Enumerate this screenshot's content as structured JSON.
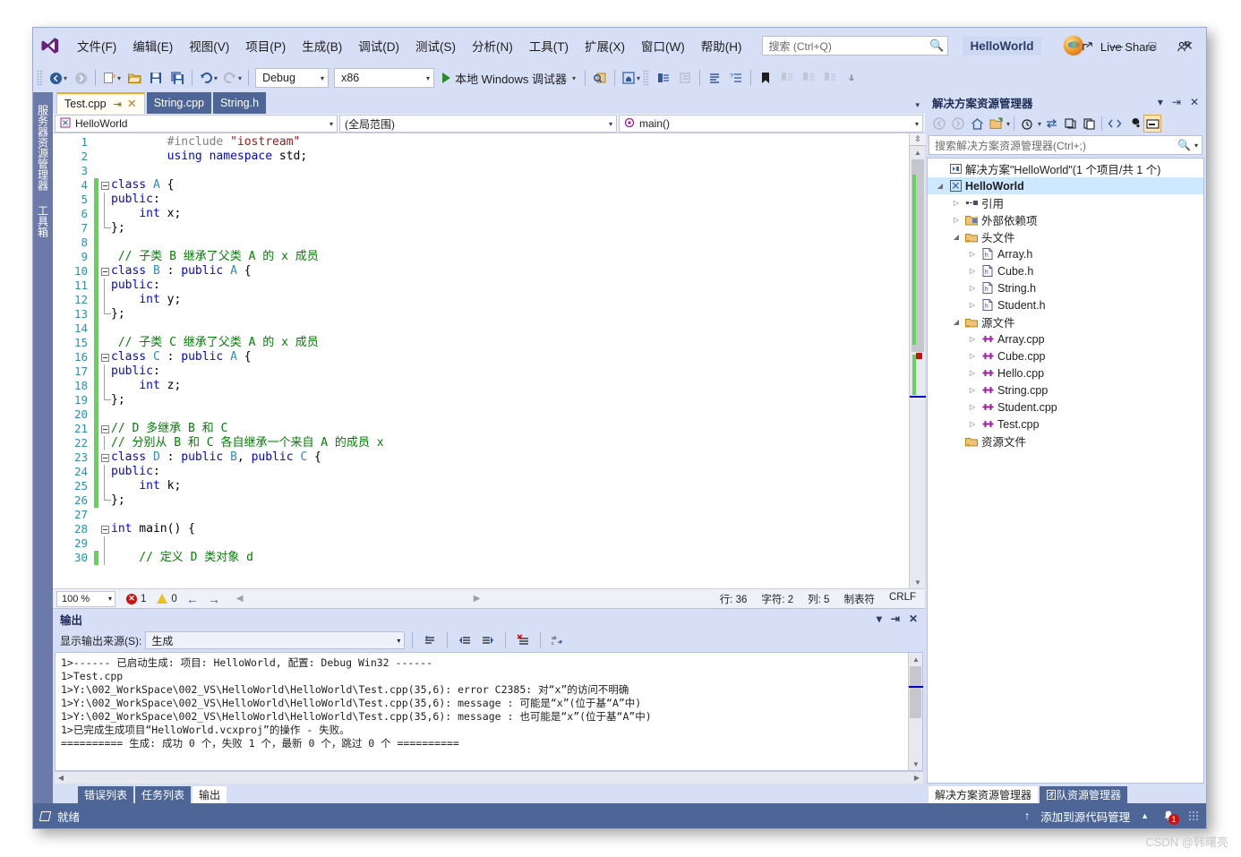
{
  "window": {
    "title": "HelloWorld",
    "minimize": "—",
    "maximize": "□",
    "close": "✕"
  },
  "menu": {
    "items": [
      {
        "label": "文件(F)"
      },
      {
        "label": "编辑(E)"
      },
      {
        "label": "视图(V)"
      },
      {
        "label": "项目(P)"
      },
      {
        "label": "生成(B)"
      },
      {
        "label": "调试(D)"
      },
      {
        "label": "测试(S)"
      },
      {
        "label": "分析(N)"
      },
      {
        "label": "工具(T)"
      },
      {
        "label": "扩展(X)"
      },
      {
        "label": "窗口(W)"
      },
      {
        "label": "帮助(H)"
      }
    ],
    "search_placeholder": "搜索 (Ctrl+Q)"
  },
  "toolbar": {
    "config_value": "Debug",
    "platform_value": "x86",
    "run_label": "本地 Windows 调试器",
    "live_share_label": "Live Share"
  },
  "left_strip": {
    "tabs": [
      "服务器资源管理器",
      "工具箱"
    ]
  },
  "editor": {
    "tabs": [
      {
        "label": "Test.cpp",
        "active": true,
        "pin": "⇥",
        "close": "✕"
      },
      {
        "label": "String.cpp",
        "active": false
      },
      {
        "label": "String.h",
        "active": false
      }
    ],
    "nav": {
      "project": "HelloWorld",
      "scope": "(全局范围)",
      "member": "main()"
    },
    "lines": [
      {
        "n": 1,
        "change": false,
        "fold": "",
        "segs": [
          {
            "t": "        ",
            "c": "pl"
          },
          {
            "t": "#include ",
            "c": "pp"
          },
          {
            "t": "\"iostream\"",
            "c": "str"
          }
        ]
      },
      {
        "n": 2,
        "change": false,
        "fold": "",
        "segs": [
          {
            "t": "        ",
            "c": "pl"
          },
          {
            "t": "using",
            "c": "kw"
          },
          {
            "t": " ",
            "c": "pl"
          },
          {
            "t": "namespace",
            "c": "kw"
          },
          {
            "t": " std;",
            "c": "pl"
          }
        ]
      },
      {
        "n": 3,
        "change": false,
        "fold": "",
        "segs": []
      },
      {
        "n": 4,
        "change": true,
        "fold": "minus",
        "segs": [
          {
            "t": "class",
            "c": "kw"
          },
          {
            "t": " ",
            "c": "pl"
          },
          {
            "t": "A",
            "c": "ty"
          },
          {
            "t": " {",
            "c": "pl"
          }
        ]
      },
      {
        "n": 5,
        "change": true,
        "fold": "bar",
        "segs": [
          {
            "t": "public",
            "c": "kw"
          },
          {
            "t": ":",
            "c": "pl"
          }
        ]
      },
      {
        "n": 6,
        "change": true,
        "fold": "bar",
        "segs": [
          {
            "t": "    ",
            "c": "pl"
          },
          {
            "t": "int",
            "c": "kw"
          },
          {
            "t": " x;",
            "c": "pl"
          }
        ]
      },
      {
        "n": 7,
        "change": true,
        "fold": "end",
        "segs": [
          {
            "t": "};",
            "c": "pl"
          }
        ]
      },
      {
        "n": 8,
        "change": true,
        "fold": "",
        "segs": []
      },
      {
        "n": 9,
        "change": true,
        "fold": "",
        "segs": [
          {
            "t": " // 子类 B 继承了父类 A 的 x 成员",
            "c": "cmt"
          }
        ]
      },
      {
        "n": 10,
        "change": true,
        "fold": "minus",
        "segs": [
          {
            "t": "class",
            "c": "kw"
          },
          {
            "t": " ",
            "c": "pl"
          },
          {
            "t": "B",
            "c": "ty"
          },
          {
            "t": " : ",
            "c": "pl"
          },
          {
            "t": "public",
            "c": "kw"
          },
          {
            "t": " ",
            "c": "pl"
          },
          {
            "t": "A",
            "c": "ty"
          },
          {
            "t": " {",
            "c": "pl"
          }
        ]
      },
      {
        "n": 11,
        "change": true,
        "fold": "bar",
        "segs": [
          {
            "t": "public",
            "c": "kw"
          },
          {
            "t": ":",
            "c": "pl"
          }
        ]
      },
      {
        "n": 12,
        "change": true,
        "fold": "bar",
        "segs": [
          {
            "t": "    ",
            "c": "pl"
          },
          {
            "t": "int",
            "c": "kw"
          },
          {
            "t": " y;",
            "c": "pl"
          }
        ]
      },
      {
        "n": 13,
        "change": true,
        "fold": "end",
        "segs": [
          {
            "t": "};",
            "c": "pl"
          }
        ]
      },
      {
        "n": 14,
        "change": true,
        "fold": "",
        "segs": []
      },
      {
        "n": 15,
        "change": true,
        "fold": "",
        "segs": [
          {
            "t": " // 子类 C 继承了父类 A 的 x 成员",
            "c": "cmt"
          }
        ]
      },
      {
        "n": 16,
        "change": true,
        "fold": "minus",
        "segs": [
          {
            "t": "class",
            "c": "kw"
          },
          {
            "t": " ",
            "c": "pl"
          },
          {
            "t": "C",
            "c": "ty"
          },
          {
            "t": " : ",
            "c": "pl"
          },
          {
            "t": "public",
            "c": "kw"
          },
          {
            "t": " ",
            "c": "pl"
          },
          {
            "t": "A",
            "c": "ty"
          },
          {
            "t": " {",
            "c": "pl"
          }
        ]
      },
      {
        "n": 17,
        "change": true,
        "fold": "bar",
        "segs": [
          {
            "t": "public",
            "c": "kw"
          },
          {
            "t": ":",
            "c": "pl"
          }
        ]
      },
      {
        "n": 18,
        "change": true,
        "fold": "bar",
        "segs": [
          {
            "t": "    ",
            "c": "pl"
          },
          {
            "t": "int",
            "c": "kw"
          },
          {
            "t": " z;",
            "c": "pl"
          }
        ]
      },
      {
        "n": 19,
        "change": true,
        "fold": "end",
        "segs": [
          {
            "t": "};",
            "c": "pl"
          }
        ]
      },
      {
        "n": 20,
        "change": true,
        "fold": "",
        "segs": []
      },
      {
        "n": 21,
        "change": true,
        "fold": "minus",
        "segs": [
          {
            "t": "// D 多继承 B 和 C",
            "c": "cmt"
          }
        ]
      },
      {
        "n": 22,
        "change": true,
        "fold": "bar",
        "segs": [
          {
            "t": "// 分别从 B 和 C 各自继承一个来自 A 的成员 x",
            "c": "cmt"
          }
        ]
      },
      {
        "n": 23,
        "change": true,
        "fold": "minus",
        "segs": [
          {
            "t": "class",
            "c": "kw"
          },
          {
            "t": " ",
            "c": "pl"
          },
          {
            "t": "D",
            "c": "ty"
          },
          {
            "t": " : ",
            "c": "pl"
          },
          {
            "t": "public",
            "c": "kw"
          },
          {
            "t": " ",
            "c": "pl"
          },
          {
            "t": "B",
            "c": "ty"
          },
          {
            "t": ", ",
            "c": "pl"
          },
          {
            "t": "public",
            "c": "kw"
          },
          {
            "t": " ",
            "c": "pl"
          },
          {
            "t": "C",
            "c": "ty"
          },
          {
            "t": " {",
            "c": "pl"
          }
        ]
      },
      {
        "n": 24,
        "change": true,
        "fold": "bar",
        "segs": [
          {
            "t": "public",
            "c": "kw"
          },
          {
            "t": ":",
            "c": "pl"
          }
        ]
      },
      {
        "n": 25,
        "change": true,
        "fold": "bar",
        "segs": [
          {
            "t": "    ",
            "c": "pl"
          },
          {
            "t": "int",
            "c": "kw"
          },
          {
            "t": " k;",
            "c": "pl"
          }
        ]
      },
      {
        "n": 26,
        "change": true,
        "fold": "end",
        "segs": [
          {
            "t": "};",
            "c": "pl"
          }
        ]
      },
      {
        "n": 27,
        "change": false,
        "fold": "",
        "segs": []
      },
      {
        "n": 28,
        "change": false,
        "fold": "minus",
        "segs": [
          {
            "t": "int",
            "c": "kw"
          },
          {
            "t": " main() {",
            "c": "pl"
          }
        ]
      },
      {
        "n": 29,
        "change": false,
        "fold": "bar",
        "segs": []
      },
      {
        "n": 30,
        "change": true,
        "fold": "bar",
        "segs": [
          {
            "t": "    // 定义 D 类对象 d",
            "c": "cmt"
          }
        ]
      }
    ],
    "status": {
      "zoom": "100 %",
      "error_count": "1",
      "warning_count": "0",
      "line": "行: 36",
      "char": "字符: 2",
      "col": "列: 5",
      "tabs_mode": "制表符",
      "eol": "CRLF"
    }
  },
  "output": {
    "title": "输出",
    "source_label": "显示输出来源(S):",
    "source_value": "生成",
    "lines": [
      "1>------ 已启动生成: 项目: HelloWorld, 配置: Debug Win32 ------",
      "1>Test.cpp",
      "1>Y:\\002_WorkSpace\\002_VS\\HelloWorld\\HelloWorld\\Test.cpp(35,6): error C2385: 对“x”的访问不明确",
      "1>Y:\\002_WorkSpace\\002_VS\\HelloWorld\\HelloWorld\\Test.cpp(35,6): message : 可能是“x”(位于基“A”中)",
      "1>Y:\\002_WorkSpace\\002_VS\\HelloWorld\\HelloWorld\\Test.cpp(35,6): message : 也可能是“x”(位于基“A”中)",
      "1>已完成生成项目“HelloWorld.vcxproj”的操作 - 失败。",
      "========== 生成: 成功 0 个，失败 1 个，最新 0 个，跳过 0 个 =========="
    ]
  },
  "bottom_tabs": [
    {
      "label": "错误列表",
      "active": false
    },
    {
      "label": "任务列表",
      "active": false
    },
    {
      "label": "输出",
      "active": true
    }
  ],
  "solution_explorer": {
    "title": "解决方案资源管理器",
    "search_placeholder": "搜索解决方案资源管理器(Ctrl+;)",
    "tree": [
      {
        "depth": 0,
        "expander": "",
        "icon": "solution",
        "label": "解决方案\"HelloWorld\"(1 个项目/共 1 个)",
        "bold": false
      },
      {
        "depth": 0,
        "expander": "▲",
        "icon": "project",
        "label": "HelloWorld",
        "bold": true,
        "selected": true
      },
      {
        "depth": 1,
        "expander": "▷",
        "icon": "reference",
        "label": "引用",
        "bold": false
      },
      {
        "depth": 1,
        "expander": "▷",
        "icon": "extdep",
        "label": "外部依赖项",
        "bold": false
      },
      {
        "depth": 1,
        "expander": "▲",
        "icon": "folder",
        "label": "头文件",
        "bold": false
      },
      {
        "depth": 2,
        "expander": "▷",
        "icon": "hfile",
        "label": "Array.h",
        "bold": false
      },
      {
        "depth": 2,
        "expander": "▷",
        "icon": "hfile",
        "label": "Cube.h",
        "bold": false
      },
      {
        "depth": 2,
        "expander": "▷",
        "icon": "hfile",
        "label": "String.h",
        "bold": false
      },
      {
        "depth": 2,
        "expander": "▷",
        "icon": "hfile",
        "label": "Student.h",
        "bold": false
      },
      {
        "depth": 1,
        "expander": "▲",
        "icon": "folder",
        "label": "源文件",
        "bold": false
      },
      {
        "depth": 2,
        "expander": "▷",
        "icon": "cppfile",
        "label": "Array.cpp",
        "bold": false
      },
      {
        "depth": 2,
        "expander": "▷",
        "icon": "cppfile",
        "label": "Cube.cpp",
        "bold": false
      },
      {
        "depth": 2,
        "expander": "▷",
        "icon": "cppfile",
        "label": "Hello.cpp",
        "bold": false
      },
      {
        "depth": 2,
        "expander": "▷",
        "icon": "cppfile",
        "label": "String.cpp",
        "bold": false
      },
      {
        "depth": 2,
        "expander": "▷",
        "icon": "cppfile",
        "label": "Student.cpp",
        "bold": false
      },
      {
        "depth": 2,
        "expander": "▷",
        "icon": "cppfile",
        "label": "Test.cpp",
        "bold": false
      },
      {
        "depth": 1,
        "expander": "",
        "icon": "folder",
        "label": "资源文件",
        "bold": false
      }
    ],
    "tabs": [
      {
        "label": "解决方案资源管理器",
        "active": true
      },
      {
        "label": "团队资源管理器",
        "active": false
      }
    ]
  },
  "statusbar": {
    "ready": "就绪",
    "source_control": "添加到源代码管理",
    "notification_count": "1"
  },
  "watermark": "CSDN @韩曙亮",
  "colors": {
    "chrome": "#d6dff5",
    "accent_blue": "#4d6697",
    "tab_active_orange": "#f5a623",
    "keyword": "#0000ff",
    "type": "#2b91af",
    "string": "#a31515",
    "comment": "#008000",
    "error_red": "#d01010",
    "change_green": "#62d45a"
  }
}
